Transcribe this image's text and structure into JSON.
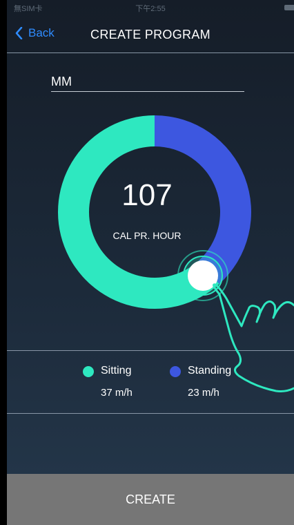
{
  "status_bar": {
    "carrier": "無SIM卡",
    "time": "下午2:55"
  },
  "nav": {
    "back_label": "Back",
    "title": "CREATE PROGRAM"
  },
  "program_name": {
    "value": "MM"
  },
  "summary": {
    "calories": "107",
    "unit_label": "CAL PR. HOUR"
  },
  "legend": [
    {
      "name": "Sitting",
      "value": "37 m/h",
      "color": "#2ee8c0"
    },
    {
      "name": "Standing",
      "value": "23 m/h",
      "color": "#3d57e0"
    }
  ],
  "chart_data": {
    "type": "pie",
    "categories": [
      "Sitting",
      "Standing"
    ],
    "values": [
      37,
      23
    ],
    "colors": [
      "#2ee8c0",
      "#3d57e0"
    ],
    "title": "107",
    "subtitle": "CAL PR. HOUR"
  },
  "actions": {
    "create_label": "CREATE"
  }
}
